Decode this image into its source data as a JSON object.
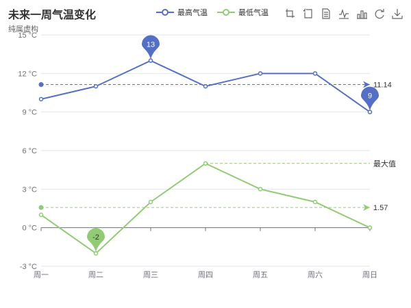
{
  "title": "未来一周气温变化",
  "subtitle": "纯属虚构",
  "legend": [
    {
      "name": "最高气温",
      "color": "#5470c6"
    },
    {
      "name": "最低气温",
      "color": "#91cc75"
    }
  ],
  "toolbox": [
    {
      "name": "data-zoom-icon"
    },
    {
      "name": "data-zoom-reset-icon"
    },
    {
      "name": "data-view-icon"
    },
    {
      "name": "line-chart-icon"
    },
    {
      "name": "bar-chart-icon"
    },
    {
      "name": "restore-icon"
    },
    {
      "name": "save-image-icon"
    }
  ],
  "chart_data": {
    "type": "line",
    "categories": [
      "周一",
      "周二",
      "周三",
      "周四",
      "周五",
      "周六",
      "周日"
    ],
    "ylim": [
      -3,
      15
    ],
    "yticks": [
      -3,
      0,
      3,
      6,
      9,
      12,
      15
    ],
    "ytick_labels": [
      "-3 °C",
      "0 °C",
      "3 °C",
      "6 °C",
      "9 °C",
      "12 °C",
      "15 °C"
    ],
    "grid": true,
    "legend_position": "top-center",
    "series": [
      {
        "name": "最高气温",
        "color": "#5470c6",
        "values": [
          10,
          11,
          13,
          11,
          12,
          12,
          9
        ],
        "mark_points": [
          {
            "label": "13",
            "index": 2,
            "value": 13
          },
          {
            "label": "9",
            "index": 6,
            "value": 9
          }
        ],
        "mark_lines": [
          {
            "label": "11.14",
            "value": 11.14
          }
        ]
      },
      {
        "name": "最低气温",
        "color": "#91cc75",
        "values": [
          1,
          -2,
          2,
          5,
          3,
          2,
          0
        ],
        "mark_points": [
          {
            "label": "-2",
            "index": 1,
            "value": -2
          }
        ],
        "mark_lines": [
          {
            "label": "1.57",
            "value": 1.57
          },
          {
            "label": "最大值",
            "from_index": 3,
            "value": 5
          }
        ]
      }
    ]
  }
}
